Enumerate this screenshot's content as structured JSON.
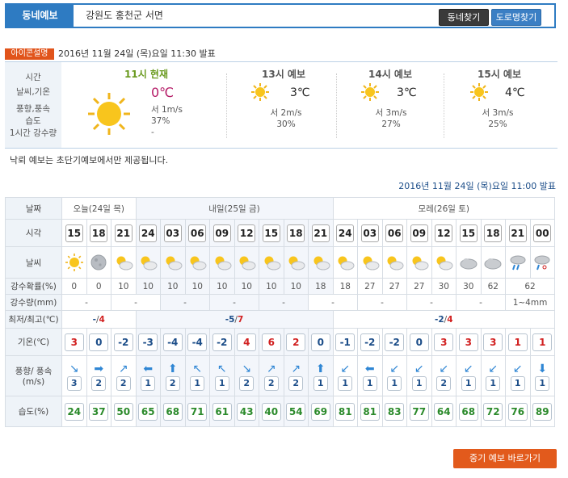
{
  "header": {
    "label": "동네예보",
    "location": "강원도 홍천군 서면",
    "btn_dong": "동네찾기",
    "btn_road": "도로명찾기"
  },
  "icon_guide": "아이콘설명",
  "issued_current": "2016년 11월 24일 (목)요일 11:30 발표",
  "current": {
    "row_labels": [
      "시간",
      "날씨,기온",
      "풍향,풍속",
      "습도",
      "1시간 강수량"
    ],
    "title": "11시 현재",
    "temp": "0℃",
    "icon": "sun-icon",
    "wind": "서 1m/s",
    "humidity": "37%",
    "precip": "-"
  },
  "forecast": [
    {
      "title": "13시 예보",
      "temp": "3℃",
      "wind": "서 2m/s",
      "humidity": "30%",
      "icon": "sun-icon"
    },
    {
      "title": "14시 예보",
      "temp": "3℃",
      "wind": "서 3m/s",
      "humidity": "27%",
      "icon": "sun-icon"
    },
    {
      "title": "15시 예보",
      "temp": "4℃",
      "wind": "서 3m/s",
      "humidity": "25%",
      "icon": "sun-icon"
    }
  ],
  "notice": "낙뢰 예보는 초단기예보에서만 제공됩니다.",
  "issued_forecast": "2016년 11월 24일 (목)요일 11:00 발표",
  "table": {
    "row_labels": {
      "date": "날짜",
      "time": "시각",
      "weather": "날씨",
      "pop": "강수확률(%)",
      "rain": "강수량(mm)",
      "minmax": "최저/최고(℃)",
      "temp": "기온(℃)",
      "wind": "풍향/ 풍속(m/s)",
      "humidity": "습도(%)"
    },
    "days": [
      {
        "label": "오늘(24일 목)",
        "minmax_min": "-",
        "minmax_max": "4"
      },
      {
        "label": "내일(25일 금)",
        "minmax_min": "-5",
        "minmax_max": "7"
      },
      {
        "label": "모레(26일 토)",
        "minmax_min": "-2",
        "minmax_max": "4"
      }
    ],
    "hours": [
      "15",
      "18",
      "21",
      "24",
      "03",
      "06",
      "09",
      "12",
      "15",
      "18",
      "21",
      "24",
      "03",
      "06",
      "09",
      "12",
      "15",
      "18",
      "21",
      "00"
    ],
    "weather_icons": [
      "sun-icon",
      "moon-icon",
      "cloud-sun-icon",
      "cloud-sun-icon",
      "cloud-sun-icon",
      "cloud-sun-icon",
      "cloud-sun-icon",
      "cloud-sun-icon",
      "cloud-sun-icon",
      "cloud-sun-icon",
      "cloud-sun-icon",
      "cloud-sun-icon",
      "cloud-sun-icon",
      "cloud-sun-icon",
      "cloud-sun-icon",
      "cloud-sun-icon",
      "cloud-icon",
      "cloud-icon",
      "rain-icon",
      "snow-icon"
    ],
    "pop": [
      "0",
      "0",
      "10",
      "10",
      "10",
      "10",
      "10",
      "10",
      "10",
      "10",
      "18",
      "18",
      "27",
      "27",
      "27",
      "30",
      "30",
      "62",
      "62"
    ],
    "rain": [
      "-",
      "-",
      "-",
      "-",
      "-",
      "-",
      "-",
      "-",
      "-",
      "1~4mm"
    ],
    "temps": [
      "3",
      "0",
      "-2",
      "-3",
      "-4",
      "-4",
      "-2",
      "4",
      "6",
      "2",
      "0",
      "-1",
      "-2",
      "-2",
      "0",
      "3",
      "3",
      "3",
      "1",
      "1"
    ],
    "wind_speed": [
      "3",
      "2",
      "2",
      "1",
      "2",
      "1",
      "1",
      "2",
      "2",
      "2",
      "1",
      "1",
      "1",
      "1",
      "1",
      "2",
      "1",
      "1",
      "1",
      "1"
    ],
    "wind_dir_glyphs": [
      "↘",
      "➡",
      "↗",
      "⬅",
      "⬆",
      "↖",
      "↖",
      "↘",
      "↗",
      "↗",
      "⬆",
      "↙",
      "⬅",
      "↙",
      "↙",
      "↙",
      "↙",
      "↙",
      "↙",
      "⬇"
    ],
    "humidity": [
      "24",
      "37",
      "50",
      "65",
      "68",
      "71",
      "61",
      "43",
      "40",
      "54",
      "69",
      "81",
      "81",
      "83",
      "77",
      "64",
      "68",
      "72",
      "76",
      "89"
    ]
  },
  "goto_button": "중기 예보 바로가기",
  "colors": {
    "accent": "#2e7bc2",
    "orange": "#e25a1c",
    "positive": "#d11f1f",
    "negative": "#1d4e89",
    "humidity": "#2b8a2b"
  }
}
